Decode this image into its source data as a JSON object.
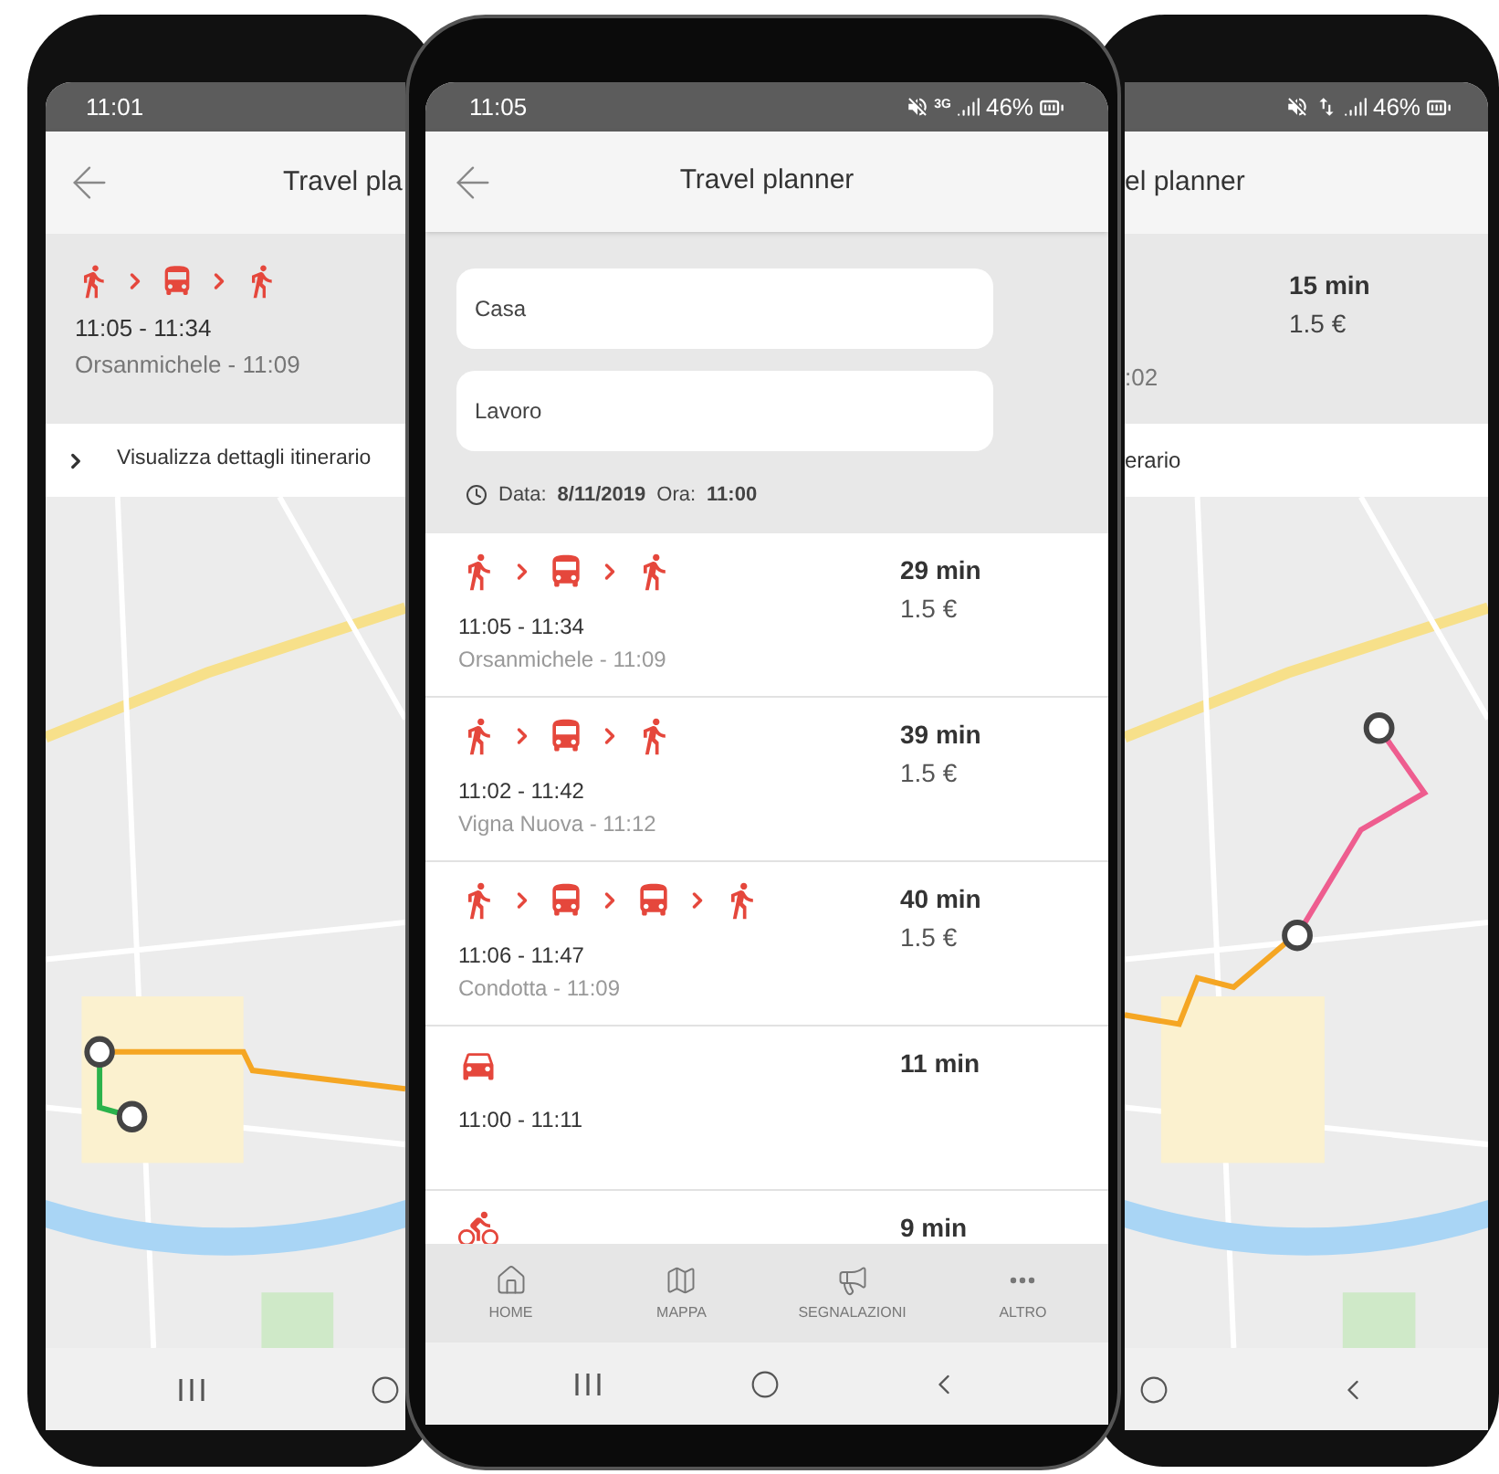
{
  "left_phone": {
    "status_time": "11:01",
    "header_title": "Travel pla",
    "route": {
      "legs": [
        {
          "kind": "walk"
        },
        {
          "kind": "bus"
        },
        {
          "kind": "walk"
        }
      ],
      "times": "11:05 - 11:34",
      "stop": "Orsanmichele - 11:09"
    },
    "details_link": "Visualizza dettagli itinerario"
  },
  "center_phone": {
    "status_bar": {
      "time": "11:05",
      "network": "3G",
      "battery": "46%"
    },
    "header_title": "Travel planner",
    "origin": "Casa",
    "destination": "Lavoro",
    "date_label": "Data:",
    "date": "8/11/2019",
    "time_label": "Ora:",
    "time": "11:00",
    "results": [
      {
        "legs": [
          {
            "kind": "walk"
          },
          {
            "kind": "bus"
          },
          {
            "kind": "walk"
          }
        ],
        "times": "11:05 - 11:34",
        "stop": "Orsanmichele - 11:09",
        "duration": "29 min",
        "price": "1.5 €"
      },
      {
        "legs": [
          {
            "kind": "walk"
          },
          {
            "kind": "bus"
          },
          {
            "kind": "walk"
          }
        ],
        "times": "11:02 - 11:42",
        "stop": "Vigna Nuova - 11:12",
        "duration": "39 min",
        "price": "1.5 €"
      },
      {
        "legs": [
          {
            "kind": "walk"
          },
          {
            "kind": "bus"
          },
          {
            "kind": "bus"
          },
          {
            "kind": "walk"
          }
        ],
        "times": "11:06 - 11:47",
        "stop": "Condotta - 11:09",
        "duration": "40 min",
        "price": "1.5 €"
      },
      {
        "legs": [
          {
            "kind": "car"
          }
        ],
        "times": "11:00 - 11:11",
        "duration": "11 min"
      },
      {
        "legs": [
          {
            "kind": "bike"
          }
        ],
        "duration": "9 min"
      }
    ],
    "bottom_nav": [
      {
        "kind": "home",
        "label": "HOME"
      },
      {
        "kind": "map",
        "label": "MAPPA"
      },
      {
        "kind": "reports",
        "label": "SEGNALAZIONI"
      },
      {
        "kind": "more",
        "label": "ALTRO"
      }
    ]
  },
  "right_phone": {
    "battery": "46%",
    "header_title": "el planner",
    "route": {
      "duration": "15 min",
      "price": "1.5 €",
      "stop": ":02"
    },
    "details_link": "erario"
  }
}
